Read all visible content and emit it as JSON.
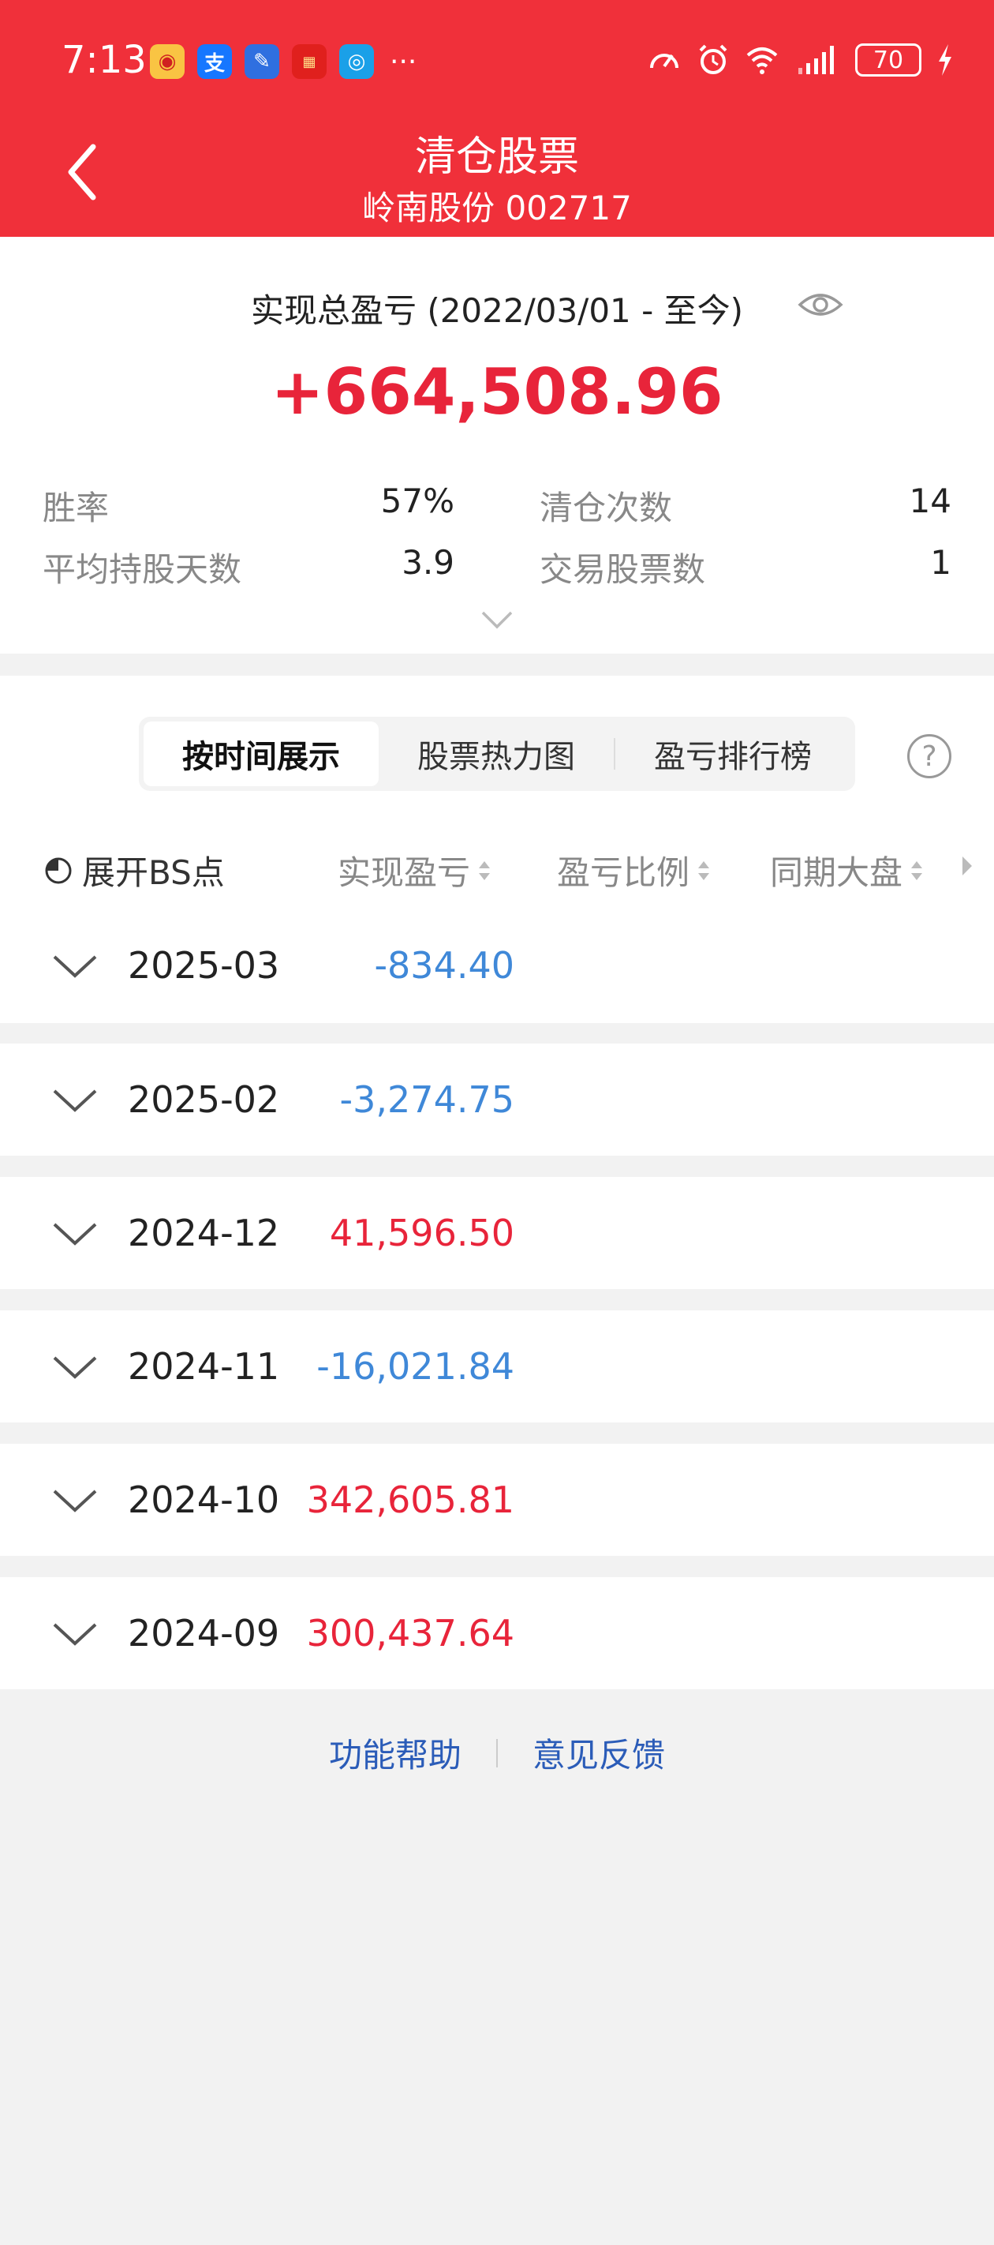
{
  "status_bar": {
    "time": "7:13",
    "battery": "70"
  },
  "header": {
    "title": "清仓股票",
    "subtitle": "岭南股份 002717"
  },
  "summary": {
    "label": "实现总盈亏 (2022/03/01 - 至今)",
    "total": "+664,508.96",
    "stats": [
      {
        "label": "胜率",
        "value": "57%"
      },
      {
        "label": "清仓次数",
        "value": "14"
      },
      {
        "label": "平均持股天数",
        "value": "3.9"
      },
      {
        "label": "交易股票数",
        "value": "1"
      }
    ]
  },
  "tabs": [
    {
      "label": "按时间展示",
      "active": true
    },
    {
      "label": "股票热力图",
      "active": false
    },
    {
      "label": "盈亏排行榜",
      "active": false
    }
  ],
  "columns": {
    "bs_toggle": "展开BS点",
    "realized": "实现盈亏",
    "ratio": "盈亏比例",
    "market": "同期大盘"
  },
  "rows": [
    {
      "month": "2025-03",
      "value": "-834.40",
      "sign": "neg"
    },
    {
      "month": "2025-02",
      "value": "-3,274.75",
      "sign": "neg"
    },
    {
      "month": "2024-12",
      "value": "41,596.50",
      "sign": "pos"
    },
    {
      "month": "2024-11",
      "value": "-16,021.84",
      "sign": "neg"
    },
    {
      "month": "2024-10",
      "value": "342,605.81",
      "sign": "pos"
    },
    {
      "month": "2024-09",
      "value": "300,437.64",
      "sign": "pos"
    }
  ],
  "footer": {
    "help": "功能帮助",
    "feedback": "意见反馈"
  },
  "colors": {
    "brand_red": "#f0303a",
    "profit": "#e8243a",
    "loss": "#3f88d8",
    "link": "#2b5cb8"
  }
}
